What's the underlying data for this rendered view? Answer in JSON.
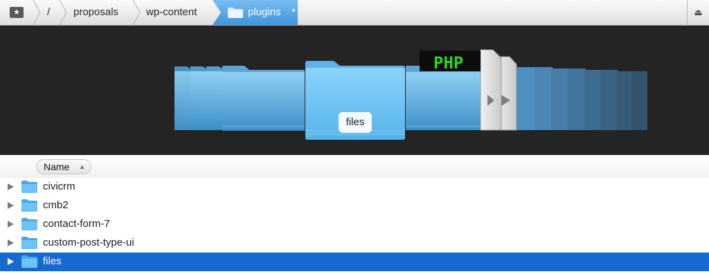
{
  "pathbar": {
    "favorites_icon": "star-folder-icon",
    "crumbs": [
      "/",
      "proposals",
      "wp-content"
    ],
    "current": "plugins",
    "current_icon": "folder-icon",
    "dropdown_icon": "chevron-down-icon",
    "eject_icon": "eject-icon",
    "accent": "#4a9de0"
  },
  "coverflow": {
    "focused_label": "files",
    "items": [
      {
        "type": "folder",
        "position": "left"
      },
      {
        "type": "folder",
        "position": "center",
        "label": "files"
      },
      {
        "type": "folder",
        "position": "right"
      },
      {
        "type": "php-file",
        "position": "right",
        "icon_text": "PHP"
      },
      {
        "type": "file",
        "position": "right"
      }
    ]
  },
  "list": {
    "header": {
      "name_label": "Name",
      "sort_icon": "sort-ascending-icon"
    },
    "rows": [
      {
        "name": "civicrm",
        "selected": false
      },
      {
        "name": "cmb2",
        "selected": false
      },
      {
        "name": "contact-form-7",
        "selected": false
      },
      {
        "name": "custom-post-type-ui",
        "selected": false
      },
      {
        "name": "files",
        "selected": true
      }
    ],
    "selection_color": "#1769d2",
    "folder_color": "#5ab8ee"
  }
}
